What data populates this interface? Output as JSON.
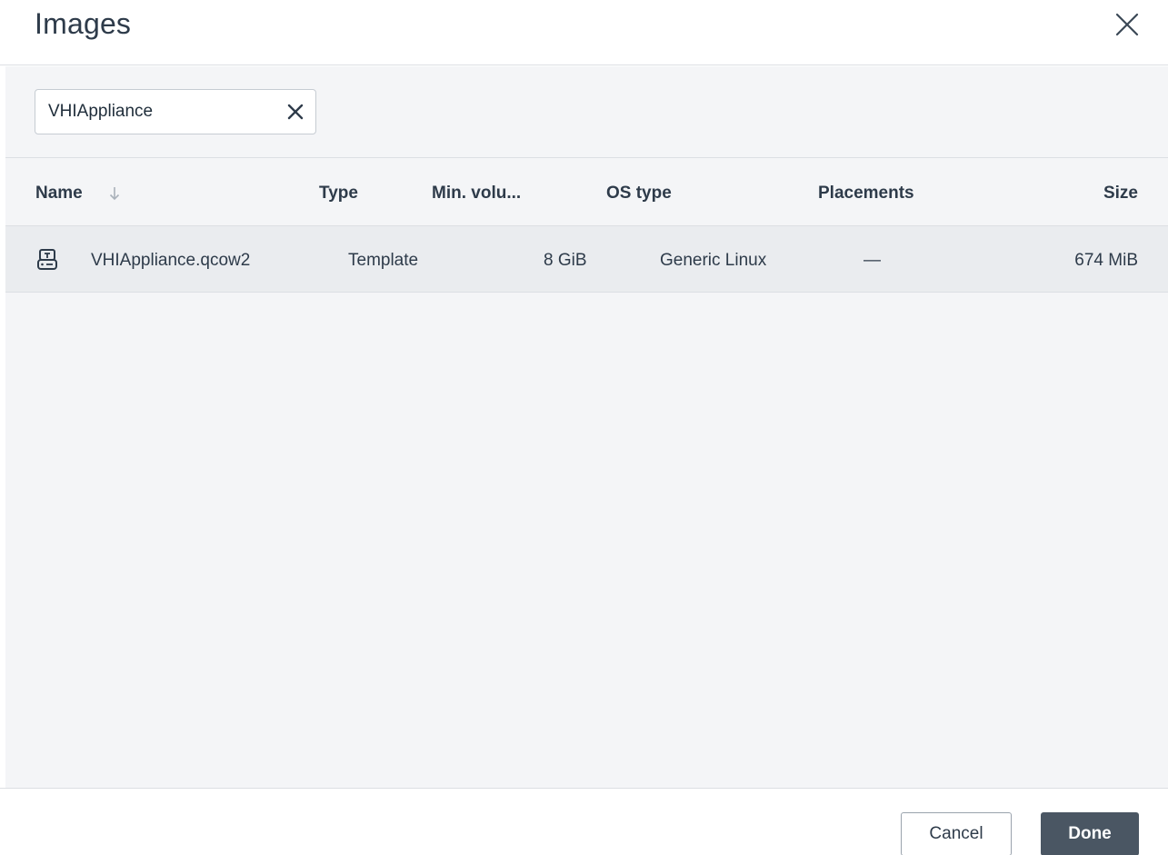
{
  "dialog": {
    "title": "Images",
    "close_icon": "close-icon"
  },
  "search": {
    "value": "VHIAppliance",
    "clear_icon": "clear-icon"
  },
  "table": {
    "columns": {
      "name": "Name",
      "type": "Type",
      "min_volume": "Min. volu...",
      "os_type": "OS type",
      "placements": "Placements",
      "size": "Size"
    },
    "sort": {
      "column": "name",
      "direction": "descending",
      "icon": "arrow-down-icon"
    },
    "rows": [
      {
        "icon": "template-disk-icon",
        "name": "VHIAppliance.qcow2",
        "type": "Template",
        "min_volume": "8 GiB",
        "os_type": "Generic Linux",
        "placements": "—",
        "size": "674 MiB"
      }
    ]
  },
  "footer": {
    "cancel_label": "Cancel",
    "done_label": "Done"
  },
  "colors": {
    "primary_button": "#4a5663",
    "panel_background": "#f4f5f7",
    "selected_row": "#eaecef"
  }
}
